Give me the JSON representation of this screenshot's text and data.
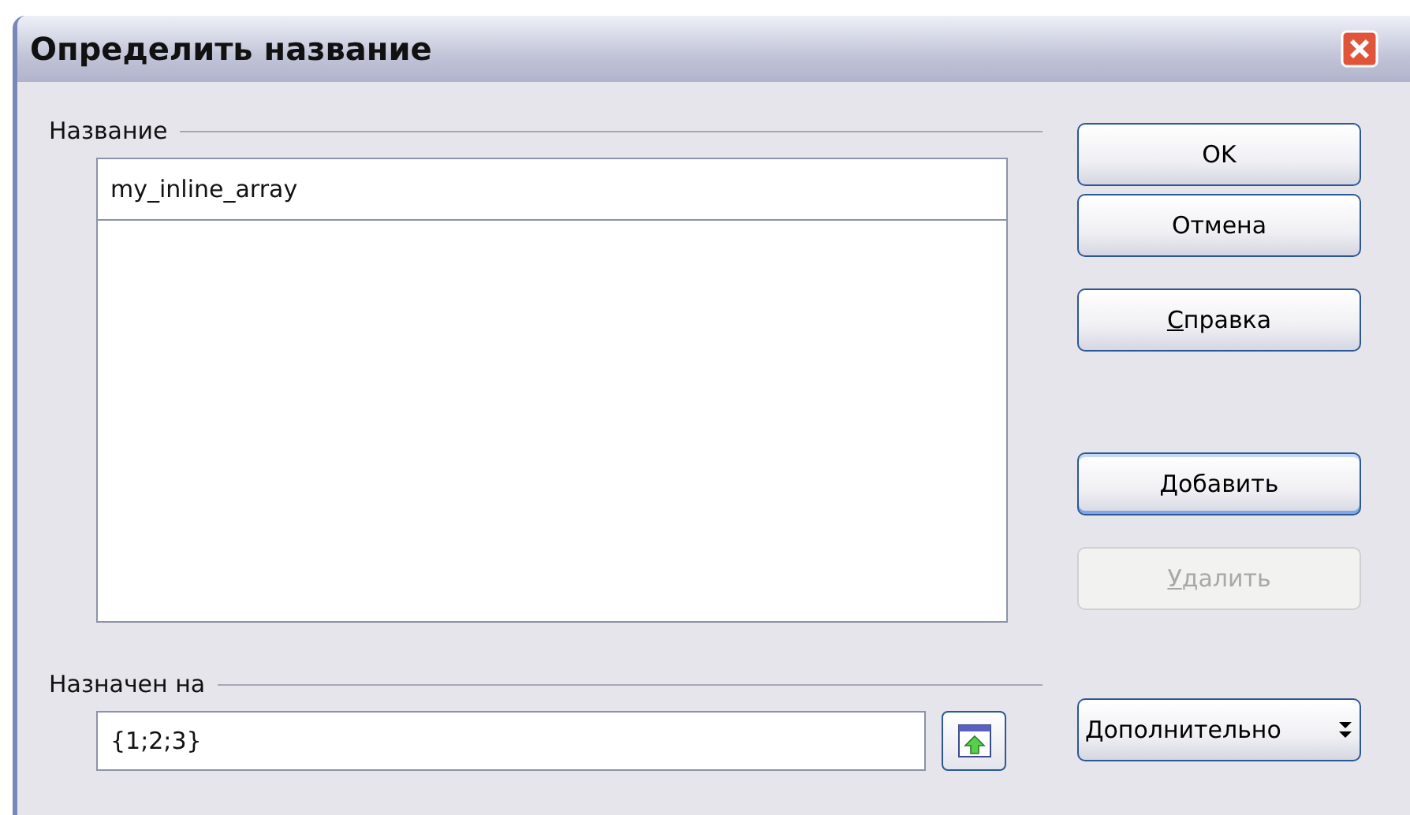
{
  "window": {
    "title": "Определить название"
  },
  "name_group": {
    "label": "Название",
    "value": "my_inline_array"
  },
  "assigned_group": {
    "label": "Назначен на",
    "value": "{1;2;3}"
  },
  "buttons": [
    {
      "label": "OK",
      "underline_first": false,
      "disabled": false,
      "default": false
    },
    {
      "label": "Отмена",
      "underline_first": false,
      "disabled": false,
      "default": false
    },
    {
      "label": "Справка",
      "underline_first": true,
      "disabled": false,
      "default": false
    },
    {
      "label": "Добавить",
      "underline_first": true,
      "disabled": false,
      "default": true
    },
    {
      "label": "Удалить",
      "underline_first": true,
      "disabled": true,
      "default": false
    }
  ],
  "more_button": {
    "label": "Дополнительно"
  }
}
